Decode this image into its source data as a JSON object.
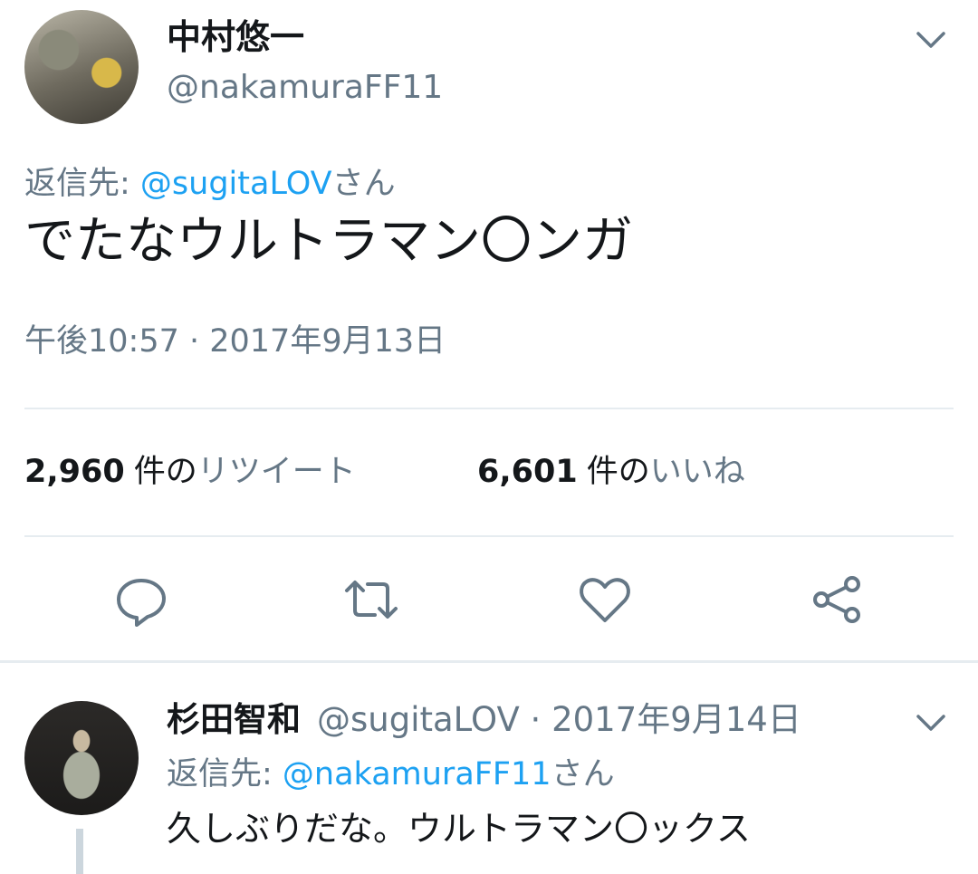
{
  "tweet": {
    "display_name": "中村悠一",
    "handle": "@nakamuraFF11",
    "reply_to_prefix": "返信先: ",
    "reply_to_handle": "@sugitaLOV",
    "reply_to_suffix": "さん",
    "text": "でたなウルトラマン〇ンガ",
    "timestamp": "午後10:57 · 2017年9月13日",
    "retweets": {
      "count": "2,960",
      "prefix": "件の",
      "label": "リツイート"
    },
    "likes": {
      "count": "6,601",
      "prefix": "件の",
      "label": "いいね"
    },
    "menu_icon": "chevron-down-icon",
    "actions": [
      "reply-icon",
      "retweet-icon",
      "like-icon",
      "share-icon"
    ]
  },
  "reply": {
    "display_name": "杉田智和",
    "handle": "@sugitaLOV",
    "separator": " · ",
    "date": "2017年9月14日",
    "reply_to_prefix": "返信先: ",
    "reply_to_handle": "@nakamuraFF11",
    "reply_to_suffix": "さん",
    "text": "久しぶりだな。ウルトラマン〇ックス",
    "menu_icon": "chevron-down-icon"
  },
  "colors": {
    "link": "#1da1f2",
    "secondary_text": "#657786",
    "icon": "#657786",
    "divider": "#e6ecf0"
  }
}
